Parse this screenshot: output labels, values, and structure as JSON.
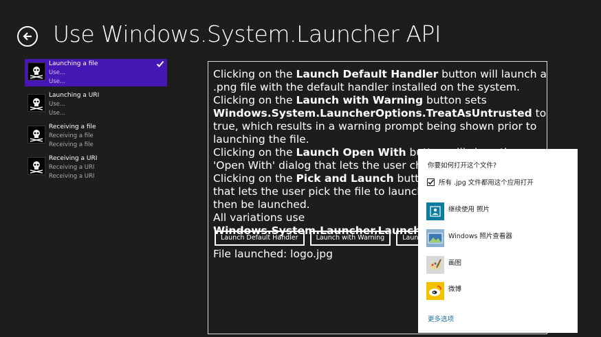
{
  "header": {
    "title": "Use Windows.System.Launcher API"
  },
  "scenarios": [
    {
      "title": "Launching a file",
      "sub1": "Use...",
      "sub2": "Use..."
    },
    {
      "title": "Launching a URI",
      "sub1": "Use...",
      "sub2": "Use..."
    },
    {
      "title": "Receiving a file",
      "sub1": "Receiving a file",
      "sub2": "Receiving a file"
    },
    {
      "title": "Receiving a URI",
      "sub1": "Receiving a URI",
      "sub2": "Receiving a URI"
    }
  ],
  "description": {
    "p1a": "Clicking on the ",
    "p1b": "Launch Default Handler",
    "p1c": " button will launch a .png file with the default handler installed on the system.",
    "p2a": "Clicking on the ",
    "p2b": "Launch with Warning",
    "p2c": " button sets ",
    "p2d": "Windows.System.LauncherOptions.TreatAsUntrusted",
    "p2e": " to true, which results in a warning prompt being shown prior to launching the file.",
    "p3a": "Clicking on the ",
    "p3b": "Launch Open With",
    "p3c": " button will show the 'Open With' dialog that lets the user chose the handler.",
    "p4a": "Clicking on the ",
    "p4b": "Pick and Launch",
    "p4c": " button will show a file picker that lets the user pick the file to launch. The picked file will then be launched.",
    "p5a": "All variations use ",
    "p5b": "Windows.System.Launcher.LaunchFileAsync."
  },
  "buttons": {
    "default": "Launch Default Handler",
    "warning": "Launch with Warning",
    "openwith": "Launch Open With"
  },
  "status": "File launched: logo.jpg",
  "flyout": {
    "title": "你要如何打开这个文件?",
    "checkbox_label": "所有 .jpg 文件都用这个应用打开",
    "checkbox_checked": true,
    "apps": [
      {
        "label": "继续使用 照片",
        "icon": "photos-app-icon"
      },
      {
        "label": "Windows 照片查看器",
        "icon": "photo-viewer-icon"
      },
      {
        "label": "画图",
        "icon": "paint-icon"
      },
      {
        "label": "微博",
        "icon": "weibo-icon"
      }
    ],
    "more": "更多选项"
  },
  "colors": {
    "background": "#1d1d1d",
    "selection": "#4617b4",
    "link": "#1f6f9c"
  }
}
